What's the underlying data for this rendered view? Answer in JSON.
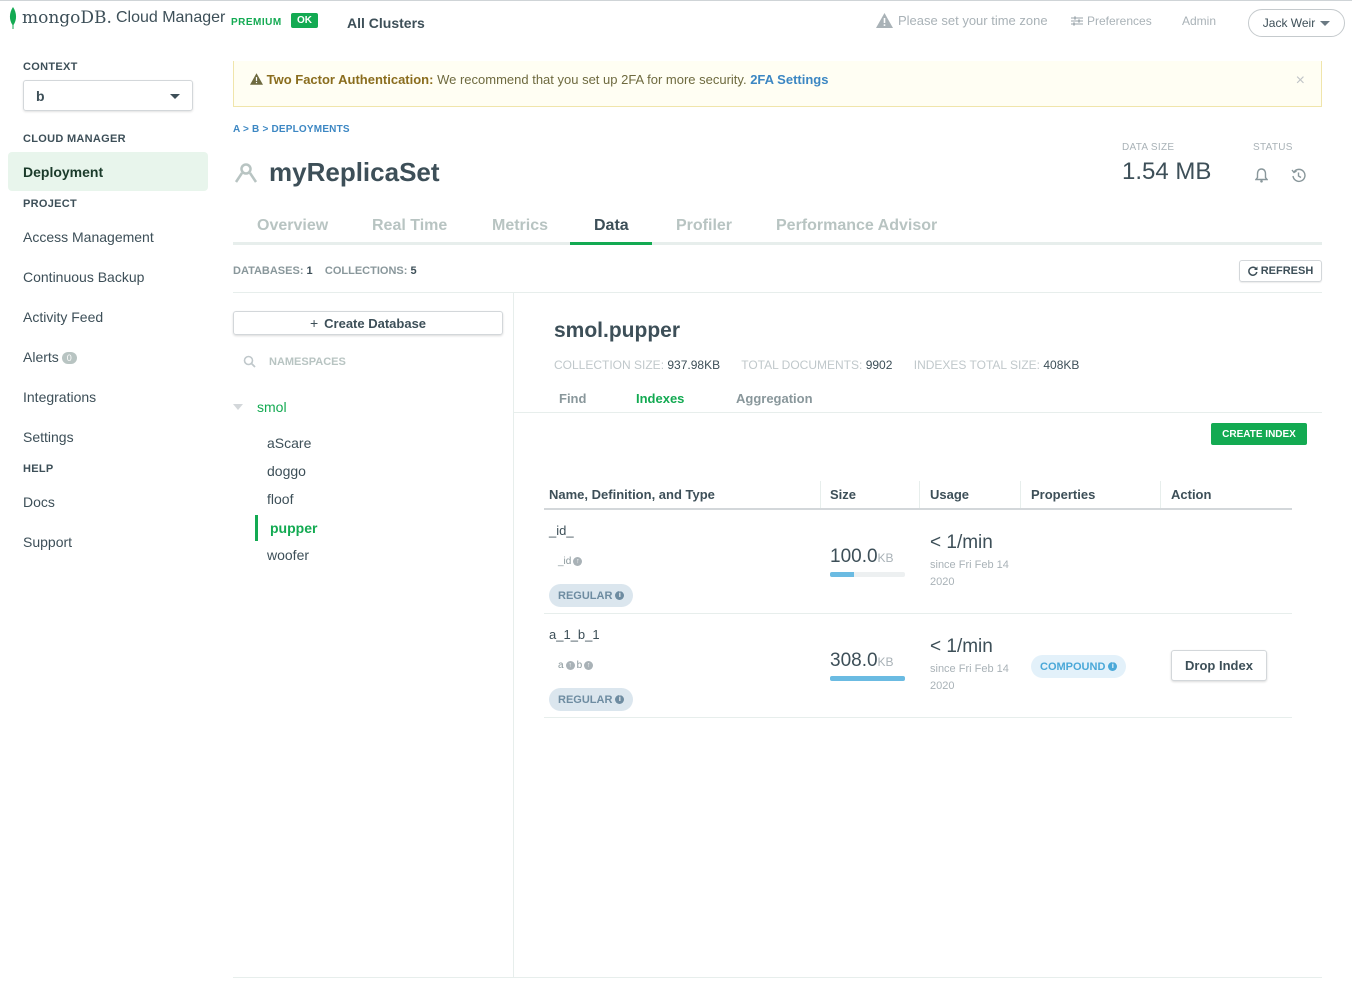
{
  "header": {
    "brand": "mongoDB.",
    "product": "Cloud Manager",
    "plan": "PREMIUM",
    "plan_status": "OK",
    "cluster_selector": "All Clusters",
    "timezone_warning": "Please set your time zone",
    "preferences": "Preferences",
    "admin": "Admin",
    "user": "Jack Weir"
  },
  "sidebar": {
    "context_heading": "CONTEXT",
    "context_value": "b",
    "cloud_manager_heading": "CLOUD MANAGER",
    "deployment": "Deployment",
    "project_heading": "PROJECT",
    "access_management": "Access Management",
    "continuous_backup": "Continuous Backup",
    "activity_feed": "Activity Feed",
    "alerts": "Alerts",
    "alerts_count": "0",
    "integrations": "Integrations",
    "settings": "Settings",
    "help_heading": "HELP",
    "docs": "Docs",
    "support": "Support"
  },
  "alert": {
    "title": "Two Factor Authentication:",
    "message": "We recommend that you set up 2FA for more security.",
    "link": "2FA Settings",
    "close": "×"
  },
  "breadcrumb": "A > B > DEPLOYMENTS",
  "deployment": {
    "name": "myReplicaSet",
    "data_size_label": "DATA SIZE",
    "data_size": "1.54 MB",
    "status_label": "STATUS"
  },
  "tabs": [
    "Overview",
    "Real Time",
    "Metrics",
    "Data",
    "Profiler",
    "Performance Advisor"
  ],
  "counts": {
    "databases_label": "DATABASES:",
    "databases": "1",
    "collections_label": "COLLECTIONS:",
    "collections": "5"
  },
  "refresh": "REFRESH",
  "namespaces": {
    "create_db": "Create Database",
    "search_placeholder": "NAMESPACES",
    "database": "smol",
    "collections": [
      "aScare",
      "doggo",
      "floof",
      "pupper",
      "woofer"
    ],
    "active": "pupper"
  },
  "collection": {
    "title": "smol.pupper",
    "size_label": "COLLECTION SIZE:",
    "size": "937.98KB",
    "docs_label": "TOTAL DOCUMENTS:",
    "docs": "9902",
    "idx_label": "INDEXES TOTAL SIZE:",
    "idx_size": "408KB",
    "subtabs": [
      "Find",
      "Indexes",
      "Aggregation"
    ],
    "create_index": "CREATE INDEX"
  },
  "index_table": {
    "headers": [
      "Name, Definition, and Type",
      "Size",
      "Usage",
      "Properties",
      "Action"
    ],
    "rows": [
      {
        "name": "_id_",
        "fields": [
          "_id"
        ],
        "type": "REGULAR",
        "size": "100.0",
        "size_unit": "KB",
        "size_fraction": 0.32,
        "usage": "< 1/min",
        "since": "since Fri Feb 14 2020",
        "property": "",
        "action": ""
      },
      {
        "name": "a_1_b_1",
        "fields": [
          "a",
          "b"
        ],
        "type": "REGULAR",
        "size": "308.0",
        "size_unit": "KB",
        "size_fraction": 1.0,
        "usage": "< 1/min",
        "since": "since Fri Feb 14 2020",
        "property": "COMPOUND",
        "action": "Drop Index"
      }
    ]
  },
  "colors": {
    "accent_green": "#13aa52",
    "link_blue": "#3c87c3",
    "size_bar": "#6bbbe2"
  }
}
